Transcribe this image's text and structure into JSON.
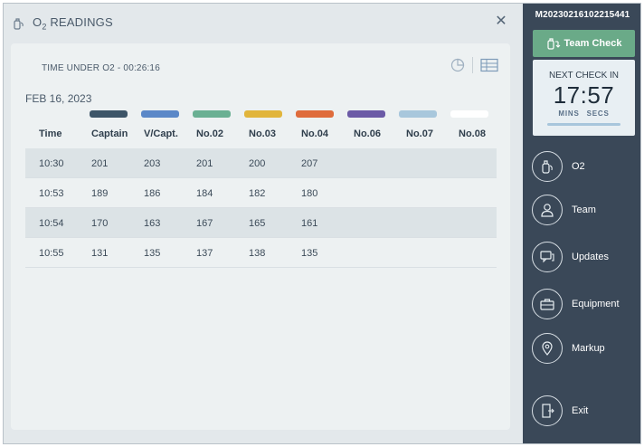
{
  "window": {
    "title_main": "O",
    "title_sub": "2",
    "title_rest": " READINGS"
  },
  "card": {
    "time_under": "TIME UNDER O2 - 00:26:16",
    "date": "FEB 16, 2023"
  },
  "columns": [
    {
      "label": "Time",
      "color": ""
    },
    {
      "label": "Captain",
      "color": "#3d5568"
    },
    {
      "label": "V/Capt.",
      "color": "#5b88c8"
    },
    {
      "label": "No.02",
      "color": "#6ab093"
    },
    {
      "label": "No.03",
      "color": "#e1b53c"
    },
    {
      "label": "No.04",
      "color": "#df6c3c"
    },
    {
      "label": "No.06",
      "color": "#6b5aa6"
    },
    {
      "label": "No.07",
      "color": "#a8c7dc"
    },
    {
      "label": "No.08",
      "color": "#ffffff"
    }
  ],
  "rows": [
    [
      "10:30",
      "201",
      "203",
      "201",
      "200",
      "207",
      "",
      "",
      ""
    ],
    [
      "10:53",
      "189",
      "186",
      "184",
      "182",
      "180",
      "",
      "",
      ""
    ],
    [
      "10:54",
      "170",
      "163",
      "167",
      "165",
      "161",
      "",
      "",
      ""
    ],
    [
      "10:55",
      "131",
      "135",
      "137",
      "138",
      "135",
      "",
      "",
      ""
    ]
  ],
  "sidebar": {
    "mission_id": "M20230216102215441",
    "team_check_label": "Team Check",
    "next_check_label": "NEXT CHECK IN",
    "next_check_time": "17:57",
    "mins_label": "MINS",
    "secs_label": "SECS",
    "nav": [
      {
        "label": "O2",
        "icon": "oxygen-tank-icon"
      },
      {
        "label": "Team",
        "icon": "person-icon"
      },
      {
        "label": "Updates",
        "icon": "chat-icon"
      },
      {
        "label": "Equipment",
        "icon": "toolbox-icon"
      },
      {
        "label": "Markup",
        "icon": "map-pin-icon"
      },
      {
        "label": "Exit",
        "icon": "exit-icon"
      }
    ]
  }
}
